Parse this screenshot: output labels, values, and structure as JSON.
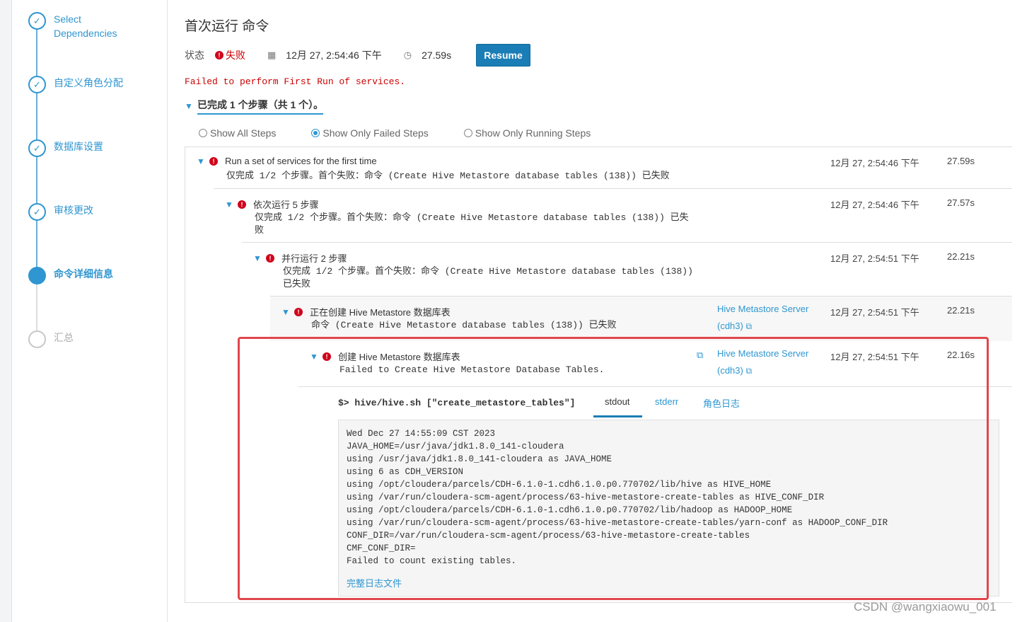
{
  "wizard": {
    "steps": [
      {
        "label": "Select Dependencies",
        "state": "done"
      },
      {
        "label": "自定义角色分配",
        "state": "done"
      },
      {
        "label": "数据库设置",
        "state": "done"
      },
      {
        "label": "审核更改",
        "state": "done"
      },
      {
        "label": "命令详细信息",
        "state": "active"
      },
      {
        "label": "汇总",
        "state": "pending"
      }
    ]
  },
  "page": {
    "title": "首次运行 命令",
    "status_label": "状态",
    "status_value": "失败",
    "start_time": "12月 27, 2:54:46 下午",
    "duration": "27.59s",
    "resume_label": "Resume",
    "failed_message": "Failed to perform First Run of services.",
    "summary": "已完成 1 个步骤（共 1 个）。"
  },
  "filters": [
    {
      "label": "Show All Steps",
      "checked": false
    },
    {
      "label": "Show Only Failed Steps",
      "checked": true
    },
    {
      "label": "Show Only Running Steps",
      "checked": false
    }
  ],
  "steps": [
    {
      "title": "Run a set of services for the first time",
      "desc": "仅完成 1/2 个步骤。首个失败：命令 (Create Hive Metastore database tables (138)) 已失败",
      "time": "12月 27, 2:54:46 下午",
      "duration": "27.59s"
    },
    {
      "title": "依次运行 5 步骤",
      "desc": "仅完成 1/2 个步骤。首个失败：命令 (Create Hive Metastore database tables (138)) 已失败",
      "time": "12月 27, 2:54:46 下午",
      "duration": "27.57s"
    },
    {
      "title": "并行运行 2 步骤",
      "desc": "仅完成 1/2 个步骤。首个失败：命令 (Create Hive Metastore database tables (138)) 已失败",
      "time": "12月 27, 2:54:51 下午",
      "duration": "22.21s"
    },
    {
      "title": "正在创建 Hive Metastore 数据库表",
      "desc": "命令 (Create Hive Metastore database tables (138)) 已失败",
      "role": "Hive Metastore Server",
      "host": "(cdh3)",
      "time": "12月 27, 2:54:51 下午",
      "duration": "22.21s"
    },
    {
      "title": "创建 Hive Metastore 数据库表",
      "desc": "Failed to Create Hive Metastore Database Tables.",
      "role": "Hive Metastore Server",
      "host": "(cdh3)",
      "time": "12月 27, 2:54:51 下午",
      "duration": "22.16s"
    }
  ],
  "command": {
    "text": "$> hive/hive.sh [\"create_metastore_tables\"]",
    "tabs": [
      "stdout",
      "stderr",
      "角色日志"
    ],
    "active_tab": "stdout",
    "log_lines": [
      "Wed Dec 27 14:55:09 CST 2023",
      "JAVA_HOME=/usr/java/jdk1.8.0_141-cloudera",
      "using /usr/java/jdk1.8.0_141-cloudera as JAVA_HOME",
      "using 6 as CDH_VERSION",
      "using /opt/cloudera/parcels/CDH-6.1.0-1.cdh6.1.0.p0.770702/lib/hive as HIVE_HOME",
      "using /var/run/cloudera-scm-agent/process/63-hive-metastore-create-tables as HIVE_CONF_DIR",
      "using /opt/cloudera/parcels/CDH-6.1.0-1.cdh6.1.0.p0.770702/lib/hadoop as HADOOP_HOME",
      "using /var/run/cloudera-scm-agent/process/63-hive-metastore-create-tables/yarn-conf as HADOOP_CONF_DIR",
      "CONF_DIR=/var/run/cloudera-scm-agent/process/63-hive-metastore-create-tables",
      "CMF_CONF_DIR=",
      "Failed to count existing tables."
    ],
    "full_log_link": "完整日志文件"
  },
  "watermark": "CSDN @wangxiaowu_001",
  "colors": {
    "accent": "#2f96d1",
    "error": "#d0021b",
    "button": "#1a7db5",
    "highlight": "#e0474c"
  }
}
